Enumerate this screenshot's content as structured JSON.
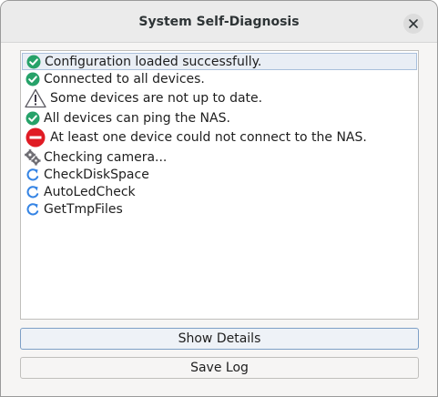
{
  "window": {
    "title": "System Self-Diagnosis",
    "close_icon": "close-icon"
  },
  "log": {
    "items": [
      {
        "icon": "check-icon",
        "text": "Configuration loaded successfully.",
        "status": "ok"
      },
      {
        "icon": "check-icon",
        "text": "Connected to all devices.",
        "status": "ok"
      },
      {
        "icon": "warning-icon",
        "text": "Some devices are not up to date.",
        "status": "warning"
      },
      {
        "icon": "check-icon",
        "text": "All devices can ping the NAS.",
        "status": "ok"
      },
      {
        "icon": "error-icon",
        "text": "At least one device could not connect to the NAS.",
        "status": "error"
      },
      {
        "icon": "gears-icon",
        "text": "Checking camera...",
        "status": "running"
      },
      {
        "icon": "refresh-icon",
        "text": "CheckDiskSpace",
        "status": "pending"
      },
      {
        "icon": "refresh-icon",
        "text": "AutoLedCheck",
        "status": "pending"
      },
      {
        "icon": "refresh-icon",
        "text": "GetTmpFiles",
        "status": "pending"
      }
    ]
  },
  "buttons": {
    "show_details": "Show Details",
    "save_log": "Save Log"
  },
  "colors": {
    "ok": "#26a269",
    "error": "#e01b24",
    "pending": "#3584e4",
    "warning_outline": "#5e5c64",
    "selection_bg": "#e9eef5",
    "selection_border": "#a9c0dc"
  }
}
